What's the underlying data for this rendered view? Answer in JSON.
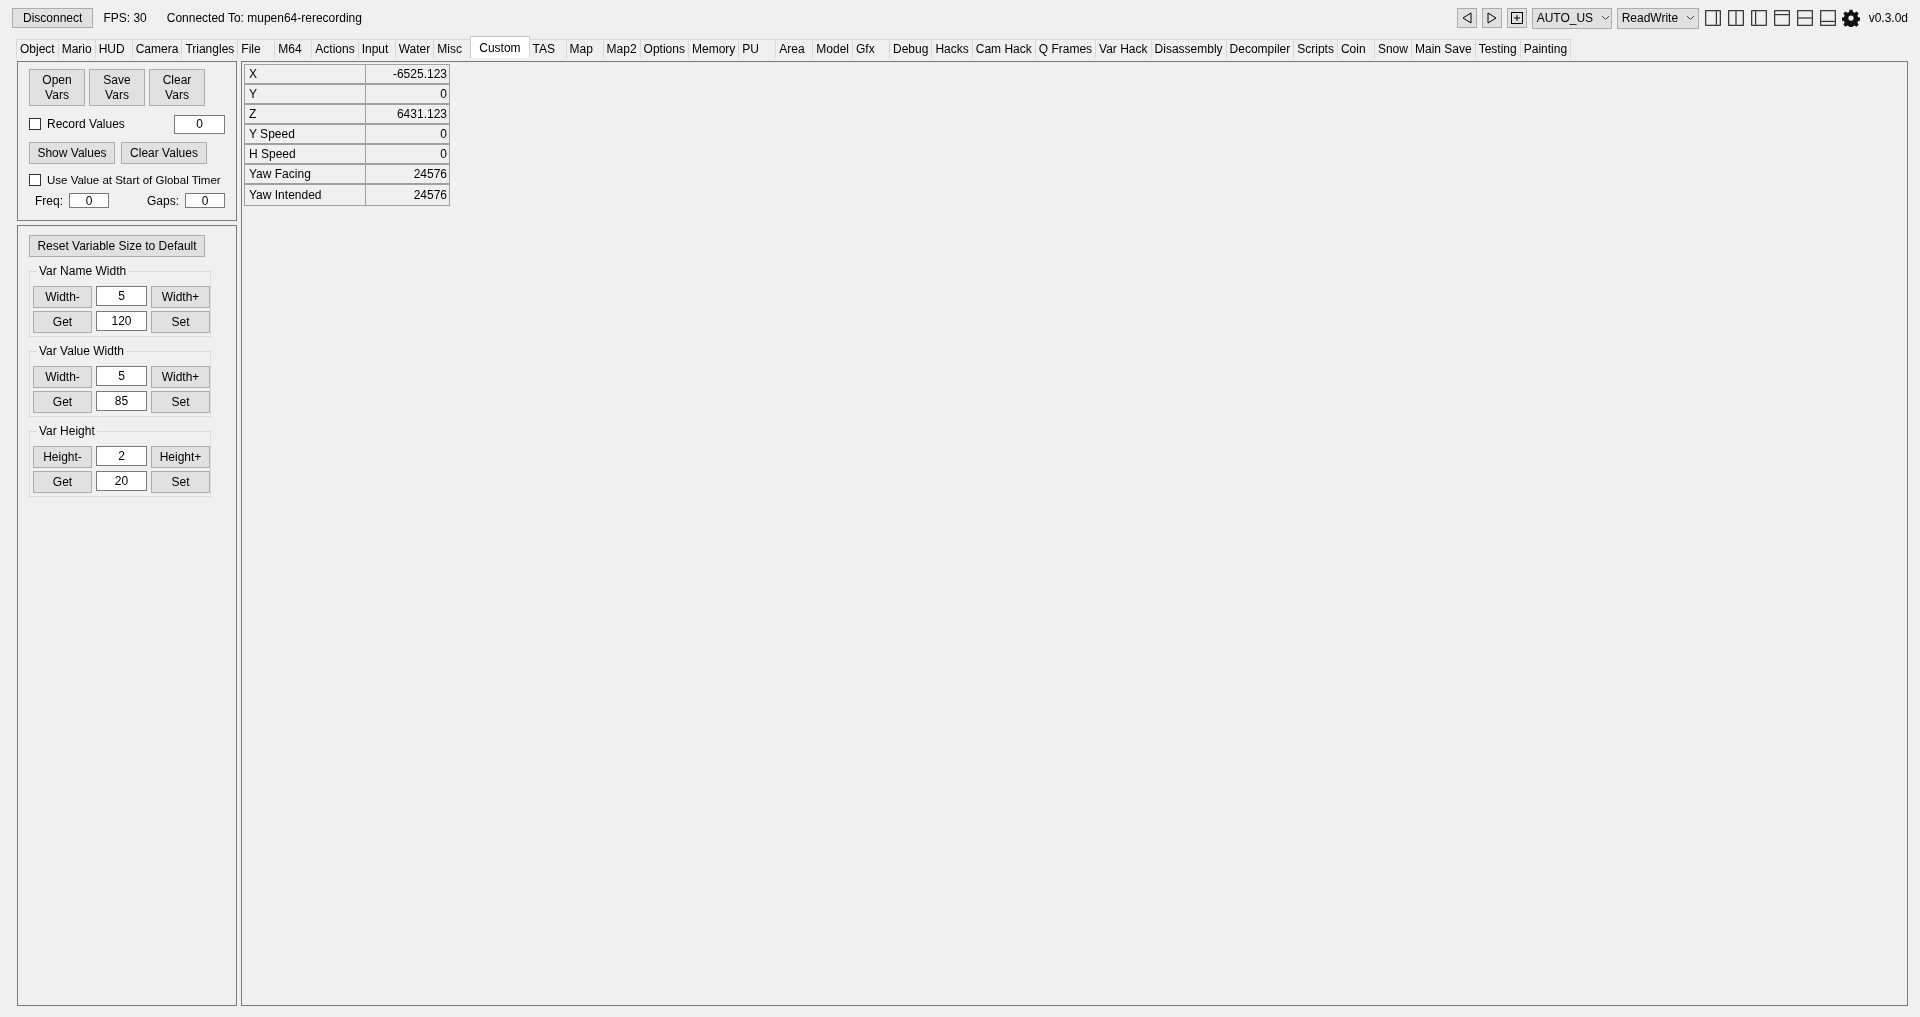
{
  "top_bar": {
    "disconnect_button": "Disconnect",
    "fps": "FPS: 30",
    "connection": "Connected To: mupen64-rerecording"
  },
  "toolbar": {
    "dropdowns": [
      {
        "value": "AUTO_US"
      },
      {
        "value": "ReadWrite"
      }
    ],
    "version": "v0.3.0d"
  },
  "tabs": [
    {
      "label": "Object",
      "selected": false
    },
    {
      "label": "Mario",
      "selected": false
    },
    {
      "label": "HUD",
      "selected": false
    },
    {
      "label": "Camera",
      "selected": false
    },
    {
      "label": "Triangles",
      "selected": false
    },
    {
      "label": "File",
      "selected": false
    },
    {
      "label": "M64",
      "selected": false
    },
    {
      "label": "Actions",
      "selected": false
    },
    {
      "label": "Input",
      "selected": false
    },
    {
      "label": "Water",
      "selected": false
    },
    {
      "label": "Misc",
      "selected": false
    },
    {
      "label": "Custom",
      "selected": true
    },
    {
      "label": "TAS",
      "selected": false
    },
    {
      "label": "Map",
      "selected": false
    },
    {
      "label": "Map2",
      "selected": false
    },
    {
      "label": "Options",
      "selected": false
    },
    {
      "label": "Memory",
      "selected": false
    },
    {
      "label": "PU",
      "selected": false
    },
    {
      "label": "Area",
      "selected": false
    },
    {
      "label": "Model",
      "selected": false
    },
    {
      "label": "Gfx",
      "selected": false
    },
    {
      "label": "Debug",
      "selected": false
    },
    {
      "label": "Hacks",
      "selected": false
    },
    {
      "label": "Cam Hack",
      "selected": false
    },
    {
      "label": "Q Frames",
      "selected": false
    },
    {
      "label": "Var Hack",
      "selected": false
    },
    {
      "label": "Disassembly",
      "selected": false
    },
    {
      "label": "Decompiler",
      "selected": false
    },
    {
      "label": "Scripts",
      "selected": false
    },
    {
      "label": "Coin",
      "selected": false
    },
    {
      "label": "Snow",
      "selected": false
    },
    {
      "label": "Main Save",
      "selected": false
    },
    {
      "label": "Testing",
      "selected": false
    },
    {
      "label": "Painting",
      "selected": false
    }
  ],
  "vars_panel": {
    "buttons": [
      "Open Vars",
      "Save Vars",
      "Clear Vars"
    ],
    "record_values": {
      "label": "Record Values",
      "checked": false,
      "value": "0"
    },
    "value_buttons": [
      "Show Values",
      "Clear Values"
    ],
    "global_timer": {
      "label": "Use Value at Start of Global Timer",
      "checked": false
    },
    "freq": {
      "label": "Freq:",
      "value": "0"
    },
    "gaps": {
      "label": "Gaps:",
      "value": "0"
    }
  },
  "size_panel": {
    "reset_button": "Reset Variable Size to Default",
    "groups": [
      {
        "title": "Var Name Width",
        "rows": [
          {
            "left": "Width-",
            "value": "5",
            "right": "Width+"
          },
          {
            "left": "Get",
            "value": "120",
            "right": "Set"
          }
        ]
      },
      {
        "title": "Var Value Width",
        "rows": [
          {
            "left": "Width-",
            "value": "5",
            "right": "Width+"
          },
          {
            "left": "Get",
            "value": "85",
            "right": "Set"
          }
        ]
      },
      {
        "title": "Var Height",
        "rows": [
          {
            "left": "Height-",
            "value": "2",
            "right": "Height+"
          },
          {
            "left": "Get",
            "value": "20",
            "right": "Set"
          }
        ]
      }
    ]
  },
  "variables": [
    {
      "name": "X",
      "value": "-6525.123"
    },
    {
      "name": "Y",
      "value": "0"
    },
    {
      "name": "Z",
      "value": "6431.123"
    },
    {
      "name": "Y Speed",
      "value": "0"
    },
    {
      "name": "H Speed",
      "value": "0"
    },
    {
      "name": "Yaw Facing",
      "value": "24576"
    },
    {
      "name": "Yaw Intended",
      "value": "24576"
    }
  ]
}
